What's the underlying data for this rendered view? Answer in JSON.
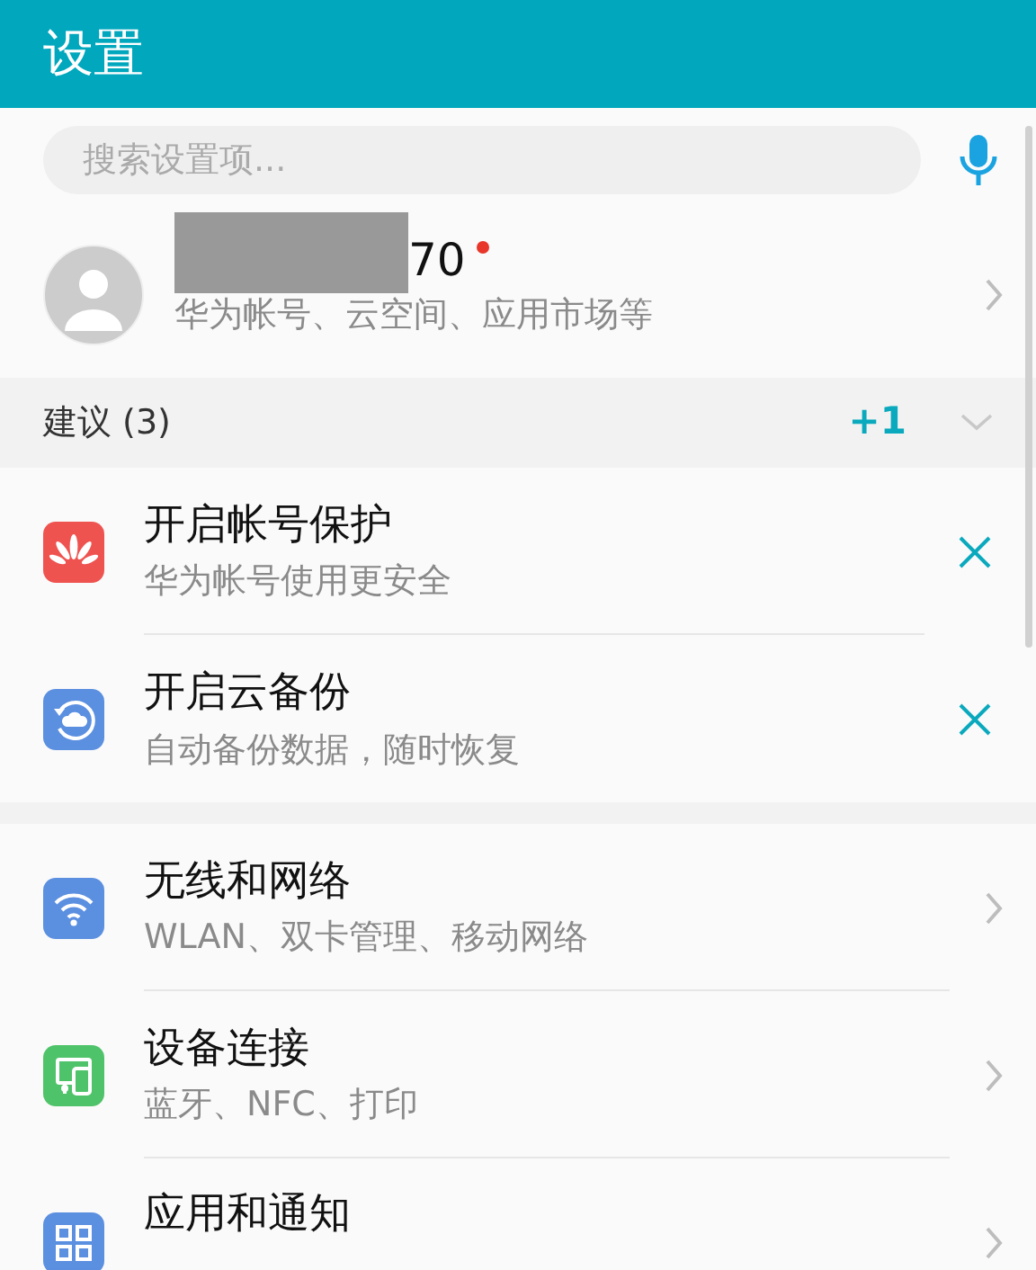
{
  "header": {
    "title": "设置"
  },
  "search": {
    "placeholder": "搜索设置项..."
  },
  "account": {
    "name": "70",
    "unread": true,
    "subtitle": "华为帐号、云空间、应用市场等"
  },
  "suggestions": {
    "title": "建议 (3)",
    "more": "+1",
    "items": [
      {
        "kind": "flower",
        "title": "开启帐号保护",
        "subtitle": "华为帐号使用更安全"
      },
      {
        "kind": "cloud",
        "title": "开启云备份",
        "subtitle": "自动备份数据，随时恢复"
      }
    ]
  },
  "settings": [
    {
      "kind": "wifi",
      "title": "无线和网络",
      "subtitle": "WLAN、双卡管理、移动网络"
    },
    {
      "kind": "devices",
      "title": "设备连接",
      "subtitle": "蓝牙、NFC、打印"
    },
    {
      "kind": "apps",
      "title": "应用和通知"
    }
  ]
}
